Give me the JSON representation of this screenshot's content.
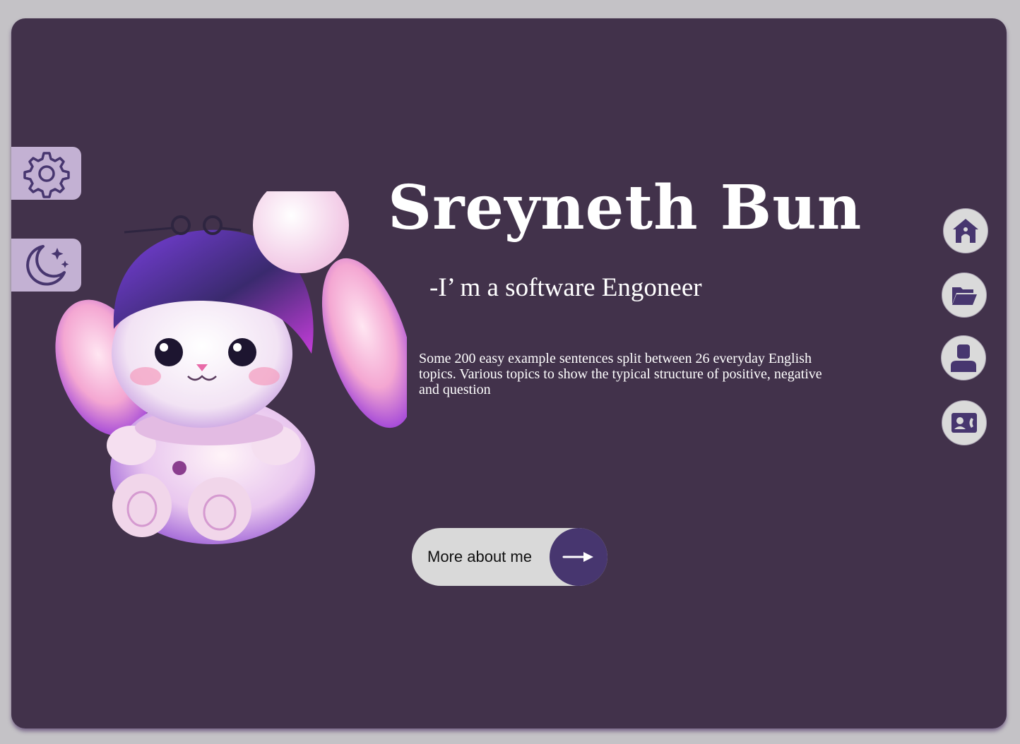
{
  "profile": {
    "name": "Sreyneth Bun",
    "role": "-I’ m a software Engoneer",
    "description": "Some 200 easy example sentences split between 26 everyday English topics. Various topics to show the typical structure of positive, negative and question"
  },
  "cta": {
    "label": "More about me",
    "icon": "arrow-right-icon"
  },
  "side_controls": [
    {
      "name": "settings",
      "icon": "gear-icon"
    },
    {
      "name": "theme-toggle",
      "icon": "moon-stars-icon"
    }
  ],
  "nav": [
    {
      "name": "home",
      "icon": "home-icon"
    },
    {
      "name": "projects",
      "icon": "folder-open-icon"
    },
    {
      "name": "about",
      "icon": "user-icon"
    },
    {
      "name": "contact",
      "icon": "contact-card-icon"
    }
  ],
  "colors": {
    "page_background": "#c4c2c6",
    "card_background": "#42324b",
    "side_tab": "#c3b1d3",
    "icon_accent": "#47366f",
    "button_background": "#d9d9d9",
    "text": "#ffffff"
  },
  "hero_image": {
    "subject": "bunny-mascot"
  }
}
